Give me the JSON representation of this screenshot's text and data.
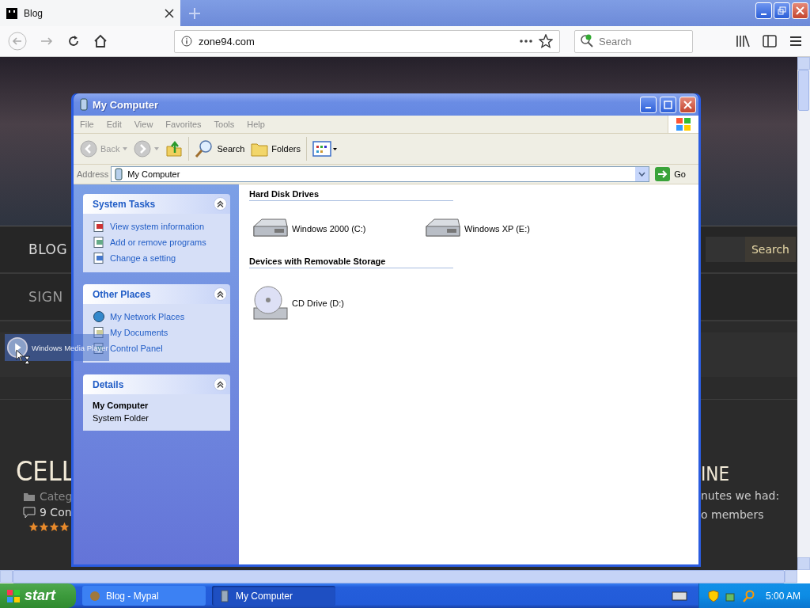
{
  "browser": {
    "tab": {
      "title": "Blog"
    },
    "url": "zone94.com",
    "search_placeholder": "Search"
  },
  "website": {
    "nav": [
      {
        "label": "BLOG"
      },
      {
        "label": "SIGN"
      }
    ],
    "search_button": "Search",
    "post_title": "CELL",
    "meta": [
      {
        "kind": "category",
        "text": "Categ"
      },
      {
        "kind": "comments",
        "text": "9 Con"
      }
    ],
    "stars": 4,
    "side_heading": "INE",
    "side_lines": [
      "nutes we had:",
      "o members"
    ]
  },
  "explorer": {
    "title": "My Computer",
    "menu": [
      "File",
      "Edit",
      "View",
      "Favorites",
      "Tools",
      "Help"
    ],
    "toolbar": [
      {
        "kind": "back",
        "label": "Back",
        "disabled": true
      },
      {
        "kind": "forward",
        "disabled": true
      },
      {
        "kind": "up"
      },
      {
        "kind": "search",
        "label": "Search"
      },
      {
        "kind": "folders",
        "label": "Folders"
      },
      {
        "kind": "views"
      }
    ],
    "address_label": "Address",
    "address": "My Computer",
    "go": "Go",
    "panels": [
      {
        "kind": "tasks",
        "title": "System Tasks",
        "expanded": true,
        "items": [
          {
            "label": "View system information"
          },
          {
            "label": "Add or remove programs"
          },
          {
            "label": "Change a setting"
          }
        ]
      },
      {
        "kind": "tasks",
        "title": "Other Places",
        "expanded": true,
        "items": [
          {
            "label": "My Network Places"
          },
          {
            "label": "My Documents"
          },
          {
            "label": "Control Panel"
          }
        ]
      },
      {
        "kind": "details",
        "title": "Details",
        "expanded": true,
        "name": "My Computer",
        "type": "System Folder"
      }
    ],
    "groups": [
      {
        "title": "Hard Disk Drives",
        "items": [
          {
            "kind": "hdd",
            "label": "Windows 2000 (C:)"
          },
          {
            "kind": "hdd",
            "label": "Windows XP (E:)"
          }
        ]
      },
      {
        "title": "Devices with Removable Storage",
        "items": [
          {
            "kind": "cd",
            "label": "CD Drive (D:)"
          }
        ]
      }
    ]
  },
  "drag": {
    "label": "Windows Media Player"
  },
  "taskbar": {
    "start": "start",
    "tasks": [
      {
        "label": "Blog - Mypal",
        "selected": false
      },
      {
        "label": "My Computer",
        "selected": true
      }
    ],
    "clock": "5:00 AM"
  }
}
